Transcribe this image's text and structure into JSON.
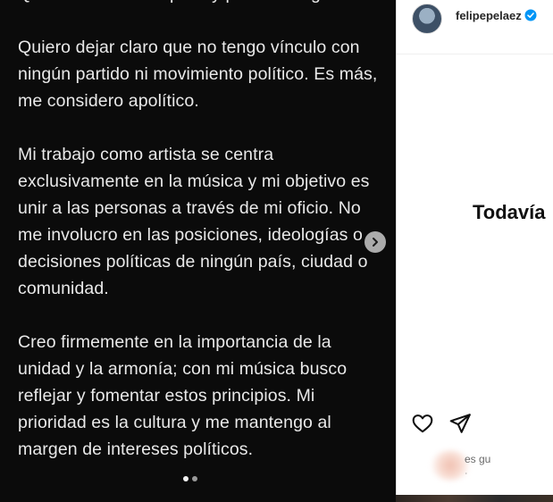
{
  "post": {
    "paragraphs": [
      "Querida familia Felipista y público en general:",
      "Quiero dejar claro que no tengo vínculo con ningún partido ni movimiento político. Es más, me considero apolítico.",
      "Mi trabajo como artista se centra exclusivamente en la música y mi objetivo es unir a las personas a través de mi oficio. No me involucro en las posiciones, ideologías o decisiones políticas de  ningún país, ciudad o comunidad.",
      "Creo firmemente en la importancia de la unidad y la armonía; con mi música busco reflejar y fomentar estos principios. Mi prioridad es la cultura y me mantengo al margen de intereses políticos."
    ],
    "next_icon": "chevron-right-icon"
  },
  "panel": {
    "username": "felipepelaez",
    "verified_icon": "verified-badge-icon",
    "caption_fragment": "Todavía",
    "comment_fragment": "es gu",
    "comment_meta": "ʾ"
  },
  "colors": {
    "verified": "#0095f6",
    "post_bg": "#0b0b0b",
    "post_text": "#e9e9e9"
  }
}
